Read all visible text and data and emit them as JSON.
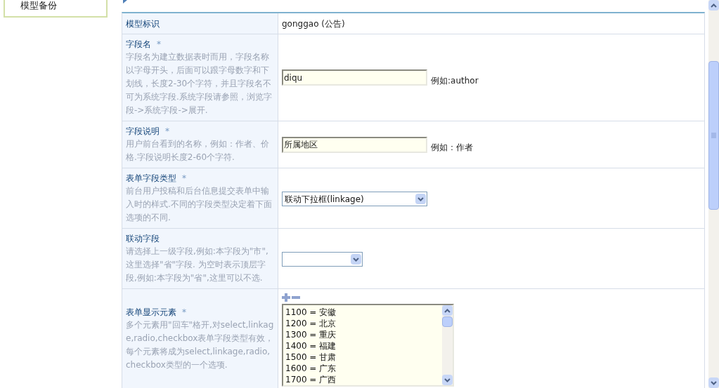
{
  "sidebar": {
    "items": [
      {
        "label": "模型备份"
      }
    ]
  },
  "form": {
    "rows": [
      {
        "kind": "text",
        "label": "模型标识",
        "value": "gonggao (公告)"
      },
      {
        "kind": "input",
        "label": "字段名",
        "mark": "*",
        "description": "字段名为建立数据表时而用，字段名称以字母开头，后面可以跟字母数字和下划线，长度2-30个字符，并且字段名不可为系统字段.系统字段请参照，浏览字段->系统字段->展开.",
        "value": "diqu",
        "example": "例如:author"
      },
      {
        "kind": "input",
        "label": "字段说明",
        "mark": "*",
        "description": "用户前台看到的名称，例如：作者、价格.字段说明长度2-60个字符.",
        "value": "所属地区",
        "example": "例如：作者"
      },
      {
        "kind": "select",
        "label": "表单字段类型",
        "mark": "*",
        "description": "前台用户投稿和后台信息提交表单中输入时的样式.不同的字段类型决定着下面选项的不同.",
        "value": "联动下拉框(linkage)"
      },
      {
        "kind": "select-small",
        "label": "联动字段",
        "description": "请选择上一级字段,例如:本字段为\"市\",这里选择\"省\"字段. 为空时表示顶层字段,例如:本字段为\"省\",这里可以不选."
      },
      {
        "kind": "list",
        "label": "表单显示元素",
        "mark": "*",
        "description": "多个元素用\"回车\"格开,对select,linkage,radio,checkbox表单字段类型有效，每个元素将成为select,linkage,radio,checkbox类型的一个选项.",
        "lines": [
          "1100 = 安徽",
          "1200 = 北京",
          "1300 = 重庆",
          "1400 = 福建",
          "1500 = 甘肃",
          "1600 = 广东",
          "1700 = 广西"
        ]
      }
    ]
  }
}
